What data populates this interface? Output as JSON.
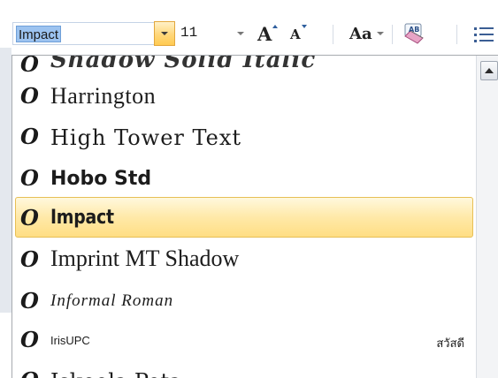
{
  "toolbar": {
    "font_name": "Impact",
    "font_size": "11",
    "grow_font_label": "A",
    "shrink_font_label": "A",
    "change_case_label": "Aa",
    "clear_formatting_label": "AB"
  },
  "font_list": {
    "items": [
      {
        "label": "Shadow Solid Italic",
        "sample": ""
      },
      {
        "label": "Harrington",
        "sample": ""
      },
      {
        "label": "High Tower Text",
        "sample": ""
      },
      {
        "label": "Hobo Std",
        "sample": ""
      },
      {
        "label": "Impact",
        "sample": "",
        "selected": true
      },
      {
        "label": "Imprint MT Shadow",
        "sample": ""
      },
      {
        "label": "Informal Roman",
        "sample": ""
      },
      {
        "label": "IrisUPC",
        "sample": "สวัสดี"
      },
      {
        "label": "Iskoola Pota",
        "sample": ""
      }
    ],
    "icon_glyph": "O"
  },
  "colors": {
    "selection_highlight": "#ffe9a8",
    "dropdown_active": "#ffd77a",
    "font_name_selection": "#9cc3f0"
  }
}
